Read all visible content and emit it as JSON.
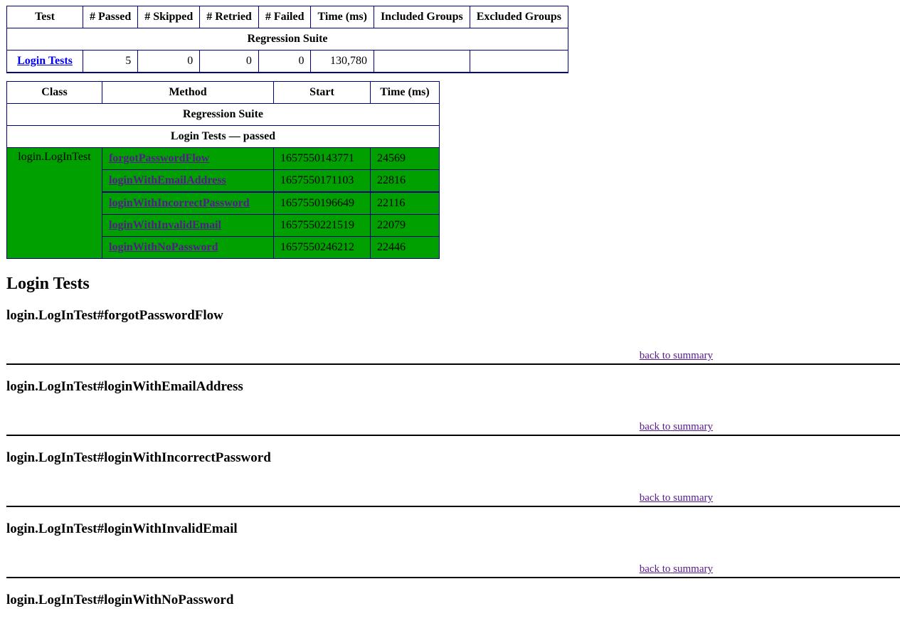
{
  "summary_table": {
    "headers": [
      "Test",
      "# Passed",
      "# Skipped",
      "# Retried",
      "# Failed",
      "Time (ms)",
      "Included Groups",
      "Excluded Groups"
    ],
    "suite_name": "Regression Suite",
    "row": {
      "test": "Login Tests",
      "passed": "5",
      "skipped": "0",
      "retried": "0",
      "failed": "0",
      "time": "130,780",
      "included_groups": "",
      "excluded_groups": ""
    }
  },
  "methods_table": {
    "headers": [
      "Class",
      "Method",
      "Start",
      "Time (ms)"
    ],
    "suite_name": "Regression Suite",
    "test_status": "Login Tests — passed",
    "class_name": "login.LogInTest",
    "pass_color": "#00a000",
    "rows": [
      {
        "method": "forgotPasswordFlow",
        "start": "1657550143771",
        "time": "24569"
      },
      {
        "method": "loginWithEmailAddress",
        "start": "1657550171103",
        "time": "22816"
      },
      {
        "method": "loginWithIncorrectPassword",
        "start": "1657550196649",
        "time": "22116"
      },
      {
        "method": "loginWithInvalidEmail",
        "start": "1657550221519",
        "time": "22079"
      },
      {
        "method": "loginWithNoPassword",
        "start": "1657550246212",
        "time": "22446"
      }
    ]
  },
  "details": {
    "title": "Login Tests",
    "back_label": "back to summary",
    "sections": [
      {
        "heading": "login.LogInTest#forgotPasswordFlow"
      },
      {
        "heading": "login.LogInTest#loginWithEmailAddress"
      },
      {
        "heading": "login.LogInTest#loginWithIncorrectPassword"
      },
      {
        "heading": "login.LogInTest#loginWithInvalidEmail"
      },
      {
        "heading": "login.LogInTest#loginWithNoPassword"
      }
    ]
  }
}
